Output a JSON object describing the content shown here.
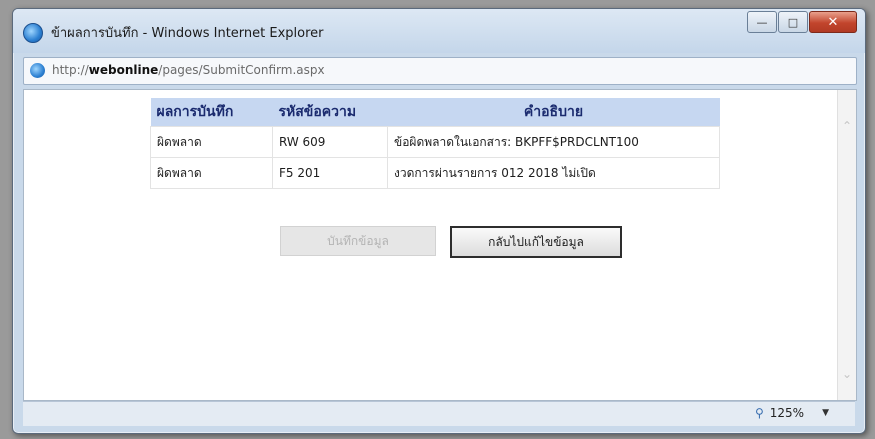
{
  "window": {
    "title": "ข้าผลการบันทึก - Windows Internet Explorer",
    "minimize_icon": "minimize-icon",
    "maximize_icon": "maximize-icon",
    "close_icon": "close-icon"
  },
  "address": {
    "prefix": "http://",
    "host": "webonline",
    "path": "/pages/SubmitConfirm.aspx"
  },
  "table": {
    "headers": [
      "ผลการบันทึก",
      "รหัสข้อความ",
      "คำอธิบาย"
    ],
    "rows": [
      [
        "ผิดพลาด",
        "RW 609",
        "ข้อผิดพลาดในเอกสาร: BKPFF$PRDCLNT100"
      ],
      [
        "ผิดพลาด",
        "F5 201",
        "งวดการผ่านรายการ 012 2018 ไม่เปิด"
      ]
    ]
  },
  "buttons": {
    "save_label": "บันทึกข้อมูล",
    "back_label": "กลับไปแก้ไขข้อมูล"
  },
  "status": {
    "zoom": "125%"
  },
  "colors": {
    "header_bg": "#c6d7f1",
    "header_text": "#1a2a6e",
    "close_button": "#c2452d"
  }
}
